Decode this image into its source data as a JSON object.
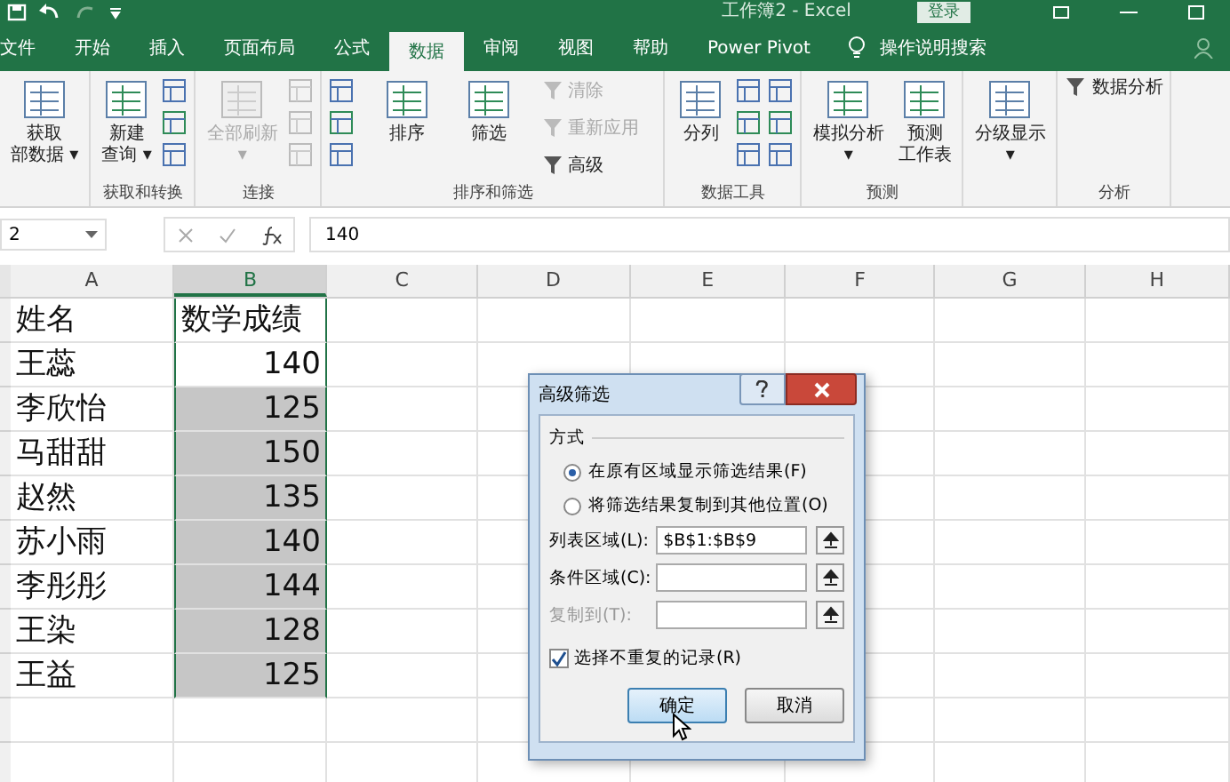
{
  "title_bar": {
    "title": "工作簿2 - Excel",
    "login": "登录"
  },
  "tabs": [
    {
      "label": "文件",
      "selected": false
    },
    {
      "label": "开始",
      "selected": false
    },
    {
      "label": "插入",
      "selected": false
    },
    {
      "label": "页面布局",
      "selected": false
    },
    {
      "label": "公式",
      "selected": false
    },
    {
      "label": "数据",
      "selected": true
    },
    {
      "label": "审阅",
      "selected": false
    },
    {
      "label": "视图",
      "selected": false
    },
    {
      "label": "帮助",
      "selected": false
    },
    {
      "label": "Power Pivot",
      "selected": false
    }
  ],
  "tell_me": "操作说明搜索",
  "ribbon": [
    {
      "items": [
        {
          "kind": "large",
          "lines": [
            "获取",
            "部数据 ▾"
          ],
          "disabled": false
        }
      ]
    },
    {
      "name": "获取和转换",
      "items": [
        {
          "kind": "large",
          "lines": [
            "新建",
            "查询 ▾"
          ],
          "disabled": false
        },
        {
          "kind": "stack",
          "disabled": false
        }
      ]
    },
    {
      "name": "连接",
      "items": [
        {
          "kind": "large",
          "lines": [
            "全部刷新",
            "▾"
          ],
          "disabled": true
        },
        {
          "kind": "stack",
          "disabled": true
        }
      ]
    },
    {
      "name": "排序和筛选",
      "items": [
        {
          "kind": "stack",
          "disabled": false
        },
        {
          "kind": "large",
          "lines": [
            "排序"
          ],
          "disabled": false
        },
        {
          "kind": "large",
          "lines": [
            "筛选"
          ],
          "disabled": false
        },
        {
          "kind": "small",
          "label": "清除",
          "disabled": true
        },
        {
          "kind": "small",
          "label": "重新应用",
          "disabled": true
        },
        {
          "kind": "small",
          "label": "高级",
          "disabled": false
        }
      ]
    },
    {
      "name": "数据工具",
      "items": [
        {
          "kind": "large",
          "lines": [
            "分列"
          ],
          "disabled": false
        },
        {
          "kind": "stack",
          "disabled": false
        },
        {
          "kind": "stack",
          "disabled": false
        }
      ]
    },
    {
      "name": "预测",
      "items": [
        {
          "kind": "large",
          "lines": [
            "模拟分析",
            "▾"
          ],
          "disabled": false
        },
        {
          "kind": "large",
          "lines": [
            "预测",
            "工作表"
          ],
          "disabled": false
        }
      ]
    },
    {
      "items": [
        {
          "kind": "large",
          "lines": [
            "分级显示",
            "▾"
          ],
          "disabled": false
        }
      ]
    },
    {
      "name": "分析",
      "items": [
        {
          "kind": "small",
          "label": "数据分析",
          "disabled": false
        }
      ]
    }
  ],
  "formula_bar": {
    "name_box": "2",
    "value": "140"
  },
  "columns": [
    {
      "label": "A",
      "selected": false
    },
    {
      "label": "B",
      "selected": true
    },
    {
      "label": "C",
      "selected": false
    },
    {
      "label": "D",
      "selected": false
    },
    {
      "label": "E",
      "selected": false
    },
    {
      "label": "F",
      "selected": false
    },
    {
      "label": "G",
      "selected": false
    },
    {
      "label": "H",
      "selected": false
    }
  ],
  "rows": [
    {
      "cells": [
        "姓名",
        "数学成绩"
      ],
      "selected": false
    },
    {
      "cells": [
        "王蕊",
        "140"
      ],
      "selected": false
    },
    {
      "cells": [
        "李欣怡",
        "125"
      ],
      "selected": true
    },
    {
      "cells": [
        "马甜甜",
        "150"
      ],
      "selected": true
    },
    {
      "cells": [
        "赵然",
        "135"
      ],
      "selected": true
    },
    {
      "cells": [
        "苏小雨",
        "140"
      ],
      "selected": true
    },
    {
      "cells": [
        "李彤彤",
        "144"
      ],
      "selected": true
    },
    {
      "cells": [
        "王染",
        "128"
      ],
      "selected": true
    },
    {
      "cells": [
        "王益",
        "125"
      ],
      "selected": true
    }
  ],
  "dialog": {
    "title": "高级筛选",
    "section": "方式",
    "options": [
      {
        "label": "在原有区域显示筛选结果(F)",
        "selected": true
      },
      {
        "label": "将筛选结果复制到其他位置(O)",
        "selected": false
      }
    ],
    "fields": [
      {
        "label": "列表区域(L):",
        "value": "$B$1:$B$9",
        "disabled": false
      },
      {
        "label": "条件区域(C):",
        "disabled": false
      },
      {
        "label": "复制到(T):",
        "disabled": true
      }
    ],
    "unique": {
      "label": "选择不重复的记录(R)",
      "checked": true
    },
    "buttons": [
      {
        "label": "确定",
        "kind": "primary"
      },
      {
        "label": "取消",
        "kind": "normal"
      }
    ]
  }
}
